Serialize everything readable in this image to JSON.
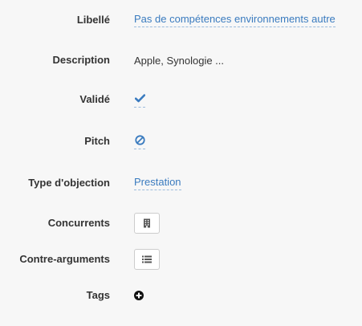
{
  "colors": {
    "link": "#3a7bbf",
    "label": "#333333",
    "background": "#f7f7f7"
  },
  "fields": {
    "libelle": {
      "label": "Libellé",
      "value": "Pas de compétences environnements autre"
    },
    "description": {
      "label": "Description",
      "value": "Apple, Synologie ..."
    },
    "valide": {
      "label": "Validé",
      "icon": "check-icon"
    },
    "pitch": {
      "label": "Pitch",
      "icon": "ban-icon"
    },
    "type_objection": {
      "label": "Type d'objection",
      "value": "Prestation"
    },
    "concurrents": {
      "label": "Concurrents",
      "icon": "building-icon"
    },
    "contre_arguments": {
      "label": "Contre-arguments",
      "icon": "list-icon"
    },
    "tags": {
      "label": "Tags",
      "icon": "plus-circle-icon"
    }
  }
}
